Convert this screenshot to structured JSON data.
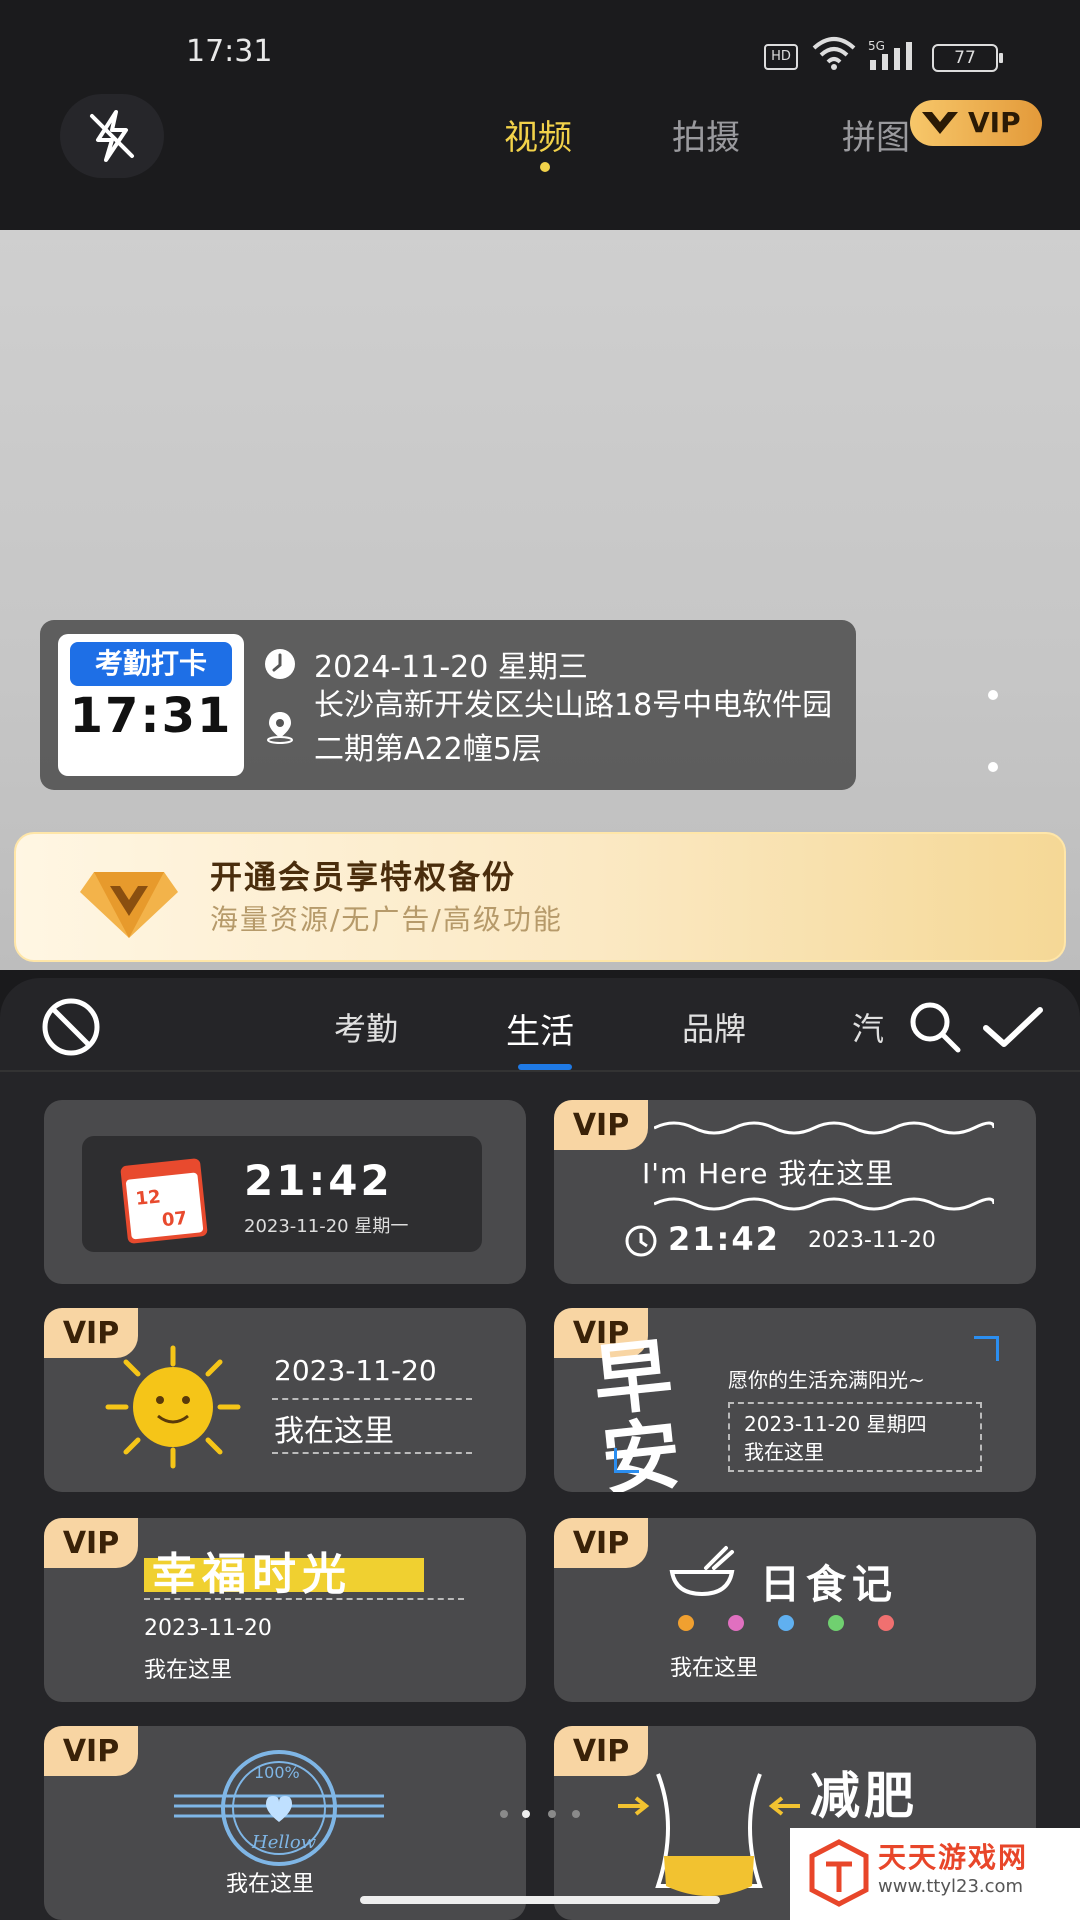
{
  "status_bar": {
    "time": "17:31",
    "hd": "HD",
    "network": "5G",
    "battery": "77"
  },
  "top_nav": {
    "tabs": [
      {
        "label": "视频",
        "active": true
      },
      {
        "label": "拍摄",
        "active": false
      },
      {
        "label": "拼图",
        "active": false
      }
    ],
    "vip_badge": "VIP"
  },
  "attendance_card": {
    "label": "考勤打卡",
    "time": "17:31",
    "date": "2024-11-20 星期三",
    "address": "长沙高新开发区尖山路18号中电软件园二期第A22幢5层"
  },
  "vip_banner": {
    "title": "开通会员享特权备份",
    "subtitle": "海量资源/无广告/高级功能"
  },
  "sheet": {
    "tabs": [
      "考勤",
      "生活",
      "品牌",
      "汽"
    ],
    "active_tab": "生活"
  },
  "templates": [
    {
      "vip": false,
      "time": "21:42",
      "date": "2023-11-20 星期一",
      "cal_month": "12",
      "cal_day": "07"
    },
    {
      "vip": true,
      "vip_label": "VIP",
      "title": "I'm Here 我在这里",
      "time": "21:42",
      "date": "2023-11-20"
    },
    {
      "vip": true,
      "vip_label": "VIP",
      "date": "2023-11-20",
      "text": "我在这里"
    },
    {
      "vip": true,
      "vip_label": "VIP",
      "big": "早安",
      "slogan": "愿你的生活充满阳光~",
      "date": "2023-11-20  星期四",
      "text": "我在这里"
    },
    {
      "vip": true,
      "vip_label": "VIP",
      "title": "幸福时光",
      "date": "2023-11-20",
      "text": "我在这里"
    },
    {
      "vip": true,
      "vip_label": "VIP",
      "title": "日食记",
      "text": "我在这里"
    },
    {
      "vip": true,
      "vip_label": "VIP",
      "stamp_pct": "100%",
      "stamp_word": "Hellow",
      "text": "我在这里"
    },
    {
      "vip": true,
      "vip_label": "VIP",
      "title": "减肥"
    }
  ],
  "watermark": {
    "name": "天天游戏网",
    "url": "www.ttyl23.com"
  },
  "colors": {
    "accent_yellow": "#f2d24a",
    "active_blue": "#1f7ae6",
    "vip_tag": "#f8d5a3"
  }
}
